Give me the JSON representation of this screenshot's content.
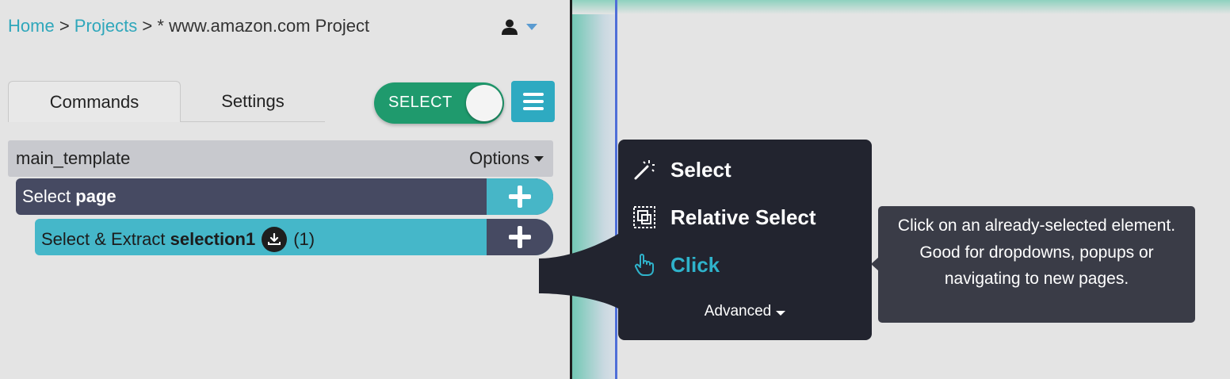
{
  "breadcrumb": {
    "home": "Home",
    "sep1": ">",
    "projects": "Projects",
    "sep2": ">",
    "project": "* www.amazon.com Project"
  },
  "tabs": {
    "commands": "Commands",
    "settings": "Settings"
  },
  "toggle": {
    "label": "SELECT",
    "state": "on",
    "color": "#1f9a6d"
  },
  "template": {
    "name": "main_template",
    "options_label": "Options"
  },
  "commands": [
    {
      "prefix": "Select ",
      "name": "page"
    },
    {
      "prefix": "Select & Extract ",
      "name": "selection1",
      "count": "(1)"
    }
  ],
  "popover": {
    "items": [
      {
        "label": "Select",
        "icon": "magic-wand-icon"
      },
      {
        "label": "Relative Select",
        "icon": "relative-select-icon"
      },
      {
        "label": "Click",
        "icon": "pointer-hand-icon",
        "active": true
      }
    ],
    "advanced_label": "Advanced"
  },
  "tooltip": {
    "text": "Click on an already-selected element. Good for dropdowns, popups or navigating to new pages."
  },
  "colors": {
    "accent": "#2eaac1",
    "row_dark": "#464a62",
    "row_light": "#45b7c9",
    "popover_bg": "#22242f"
  }
}
